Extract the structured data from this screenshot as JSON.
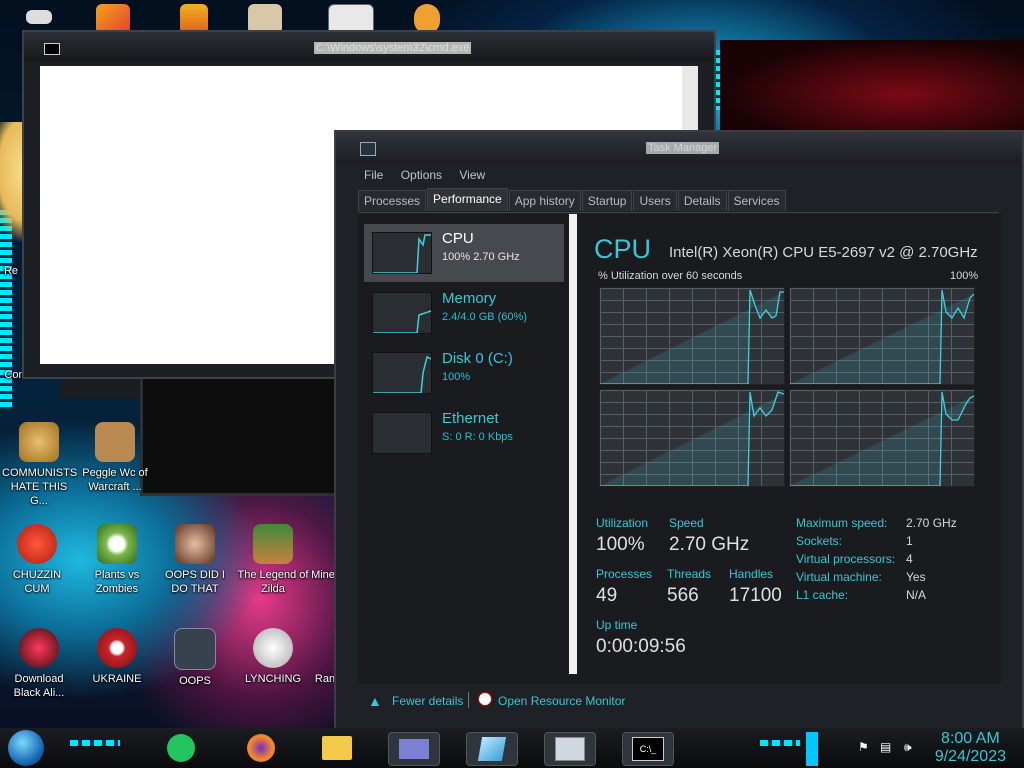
{
  "desktop": {
    "icons": [
      {
        "label": "COMMUNISTS HATE THIS G...",
        "color": "#d9a34a"
      },
      {
        "label": "Peggle Wc of Warcraft ...",
        "color": "#b88a52"
      },
      {
        "label": "CHUZZIN CUM",
        "color": "#d93b2c"
      },
      {
        "label": "Plants vs Zombies",
        "color": "#7bb84a"
      },
      {
        "label": "OOPS DID I DO THAT",
        "color": "#c48a72"
      },
      {
        "label": "The Legend of Zilda",
        "color": "#3f8a3a"
      },
      {
        "label": "Mine",
        "color": "#6a6a6a"
      },
      {
        "label": "Download Black Ali...",
        "color": "#8a1a2a"
      },
      {
        "label": "UKRAINE",
        "color": "#c8242c"
      },
      {
        "label": "OOPS",
        "color": "#38424e"
      },
      {
        "label": "LYNCHING",
        "color": "#cfcfcf"
      },
      {
        "label": "Ran",
        "color": "#555"
      },
      {
        "label": "Re",
        "color": "#444"
      },
      {
        "label": "Contro",
        "color": "#444"
      }
    ]
  },
  "cmd_window": {
    "title": "C:\\Windows\\system32\\cmd.exe"
  },
  "task_manager": {
    "title": "Task Manager",
    "menu": [
      "File",
      "Options",
      "View"
    ],
    "tabs": [
      "Processes",
      "Performance",
      "App history",
      "Startup",
      "Users",
      "Details",
      "Services"
    ],
    "active_tab": "Performance",
    "sidebar": [
      {
        "name": "CPU",
        "sub": "100%  2.70 GHz",
        "selected": true
      },
      {
        "name": "Memory",
        "sub": "2.4/4.0 GB (60%)",
        "selected": false
      },
      {
        "name": "Disk 0 (C:)",
        "sub": "100%",
        "selected": false
      },
      {
        "name": "Ethernet",
        "sub": "S: 0  R: 0 Kbps",
        "selected": false
      }
    ],
    "main": {
      "title": "CPU",
      "cpu_name": "Intel(R) Xeon(R) CPU E5-2697 v2 @ 2.70GHz",
      "graph_label": "% Utilization over 60 seconds",
      "graph_max": "100%",
      "stats": {
        "utilization_label": "Utilization",
        "utilization": "100%",
        "speed_label": "Speed",
        "speed": "2.70 GHz",
        "processes_label": "Processes",
        "processes": "49",
        "threads_label": "Threads",
        "threads": "566",
        "handles_label": "Handles",
        "handles": "17100",
        "uptime_label": "Up time",
        "uptime": "0:00:09:56"
      },
      "details": [
        {
          "key": "Maximum speed:",
          "value": "2.70 GHz"
        },
        {
          "key": "Sockets:",
          "value": "1"
        },
        {
          "key": "Virtual processors:",
          "value": "4"
        },
        {
          "key": "Virtual machine:",
          "value": "Yes"
        },
        {
          "key": "L1 cache:",
          "value": "N/A"
        }
      ]
    },
    "footer": {
      "fewer_details": "Fewer details",
      "resource_monitor": "Open Resource Monitor"
    }
  },
  "taskbar": {
    "time": "8:00 AM",
    "date": "9/24/2023"
  },
  "colors": {
    "accent": "#37c7d6",
    "graph_line": "#3fd0dc"
  }
}
